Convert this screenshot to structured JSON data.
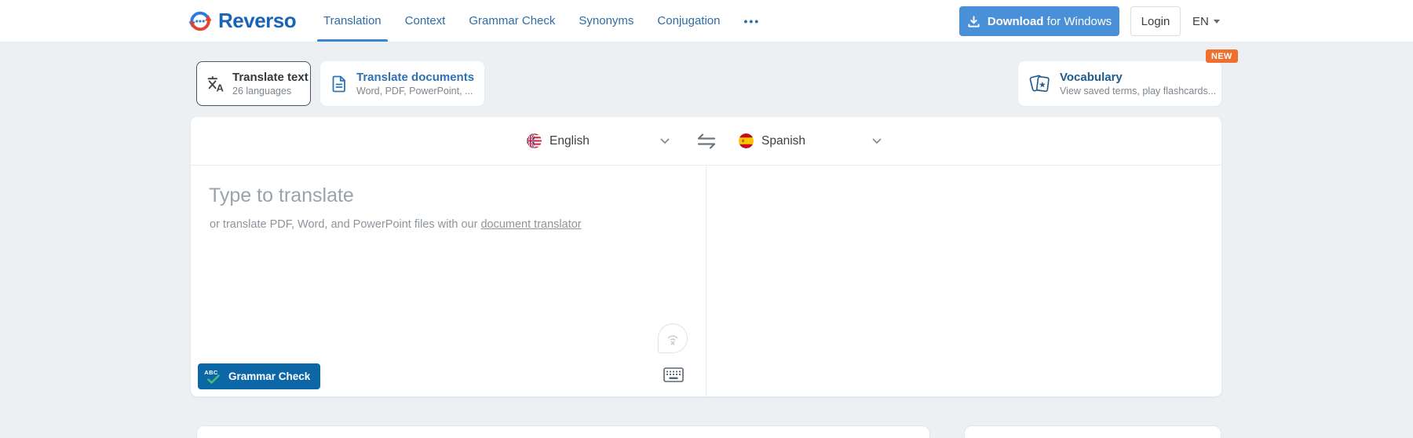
{
  "header": {
    "logo_text": "Reverso",
    "nav": [
      {
        "label": "Translation",
        "active": true
      },
      {
        "label": "Context"
      },
      {
        "label": "Grammar Check"
      },
      {
        "label": "Synonyms"
      },
      {
        "label": "Conjugation"
      },
      {
        "label": "•••"
      }
    ],
    "download_button": {
      "bold": "Download",
      "rest": "for Windows"
    },
    "login_label": "Login",
    "locale_label": "EN"
  },
  "mode_cards": {
    "translate_text": {
      "title": "Translate text",
      "subtitle": "26 languages"
    },
    "translate_documents": {
      "title": "Translate documents",
      "subtitle": "Word, PDF, PowerPoint, ..."
    },
    "vocabulary": {
      "title": "Vocabulary",
      "subtitle": "View saved terms, play flashcards...",
      "badge": "NEW"
    }
  },
  "translator": {
    "source_language": "English",
    "target_language": "Spanish",
    "input_placeholder": "Type to translate",
    "doc_hint_prefix": "or translate PDF, Word, and PowerPoint files with our",
    "doc_hint_link": "document translator",
    "grammar_check": {
      "label": "Grammar Check",
      "icon_text": "ABC"
    }
  },
  "colors": {
    "brand_blue": "#1a64b7",
    "brand_red": "#e2452f",
    "nav_blue": "#2f6ba6",
    "active_underline": "#3e86cb",
    "download_blue": "#4a90d9",
    "grammar_blue": "#0d67a6",
    "check_green": "#3ec079",
    "badge_orange": "#ef6f2e",
    "background": "#edf0f3"
  }
}
